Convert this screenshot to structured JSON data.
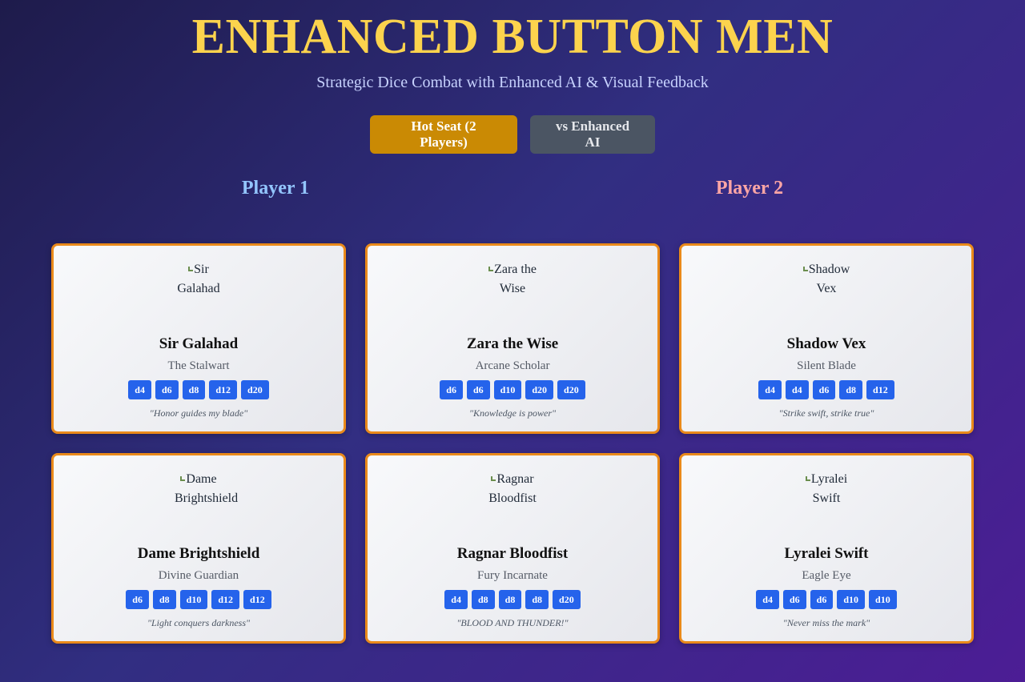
{
  "header": {
    "title": "ENHANCED BUTTON MEN",
    "subtitle": "Strategic Dice Combat with Enhanced AI & Visual Feedback"
  },
  "modes": {
    "hot_seat": "Hot Seat (2 Players)",
    "vs_ai": "vs Enhanced AI",
    "selected": "Hot Seat (2 Players)"
  },
  "players": {
    "p1": "Player 1",
    "p2": "Player 2"
  },
  "characters": [
    {
      "portrait_line1": "Sir",
      "portrait_line2": "Galahad",
      "name": "Sir Galahad",
      "role": "The Stalwart",
      "dice": [
        "d4",
        "d6",
        "d8",
        "d12",
        "d20"
      ],
      "quote": "\"Honor guides my blade\""
    },
    {
      "portrait_line1": "Zara the",
      "portrait_line2": "Wise",
      "name": "Zara the Wise",
      "role": "Arcane Scholar",
      "dice": [
        "d6",
        "d6",
        "d10",
        "d20",
        "d20"
      ],
      "quote": "\"Knowledge is power\""
    },
    {
      "portrait_line1": "Shadow",
      "portrait_line2": "Vex",
      "name": "Shadow Vex",
      "role": "Silent Blade",
      "dice": [
        "d4",
        "d4",
        "d6",
        "d8",
        "d12"
      ],
      "quote": "\"Strike swift, strike true\""
    },
    {
      "portrait_line1": "Dame",
      "portrait_line2": "Brightshield",
      "name": "Dame Brightshield",
      "role": "Divine Guardian",
      "dice": [
        "d6",
        "d8",
        "d10",
        "d12",
        "d12"
      ],
      "quote": "\"Light conquers darkness\""
    },
    {
      "portrait_line1": "Ragnar",
      "portrait_line2": "Bloodfist",
      "name": "Ragnar Bloodfist",
      "role": "Fury Incarnate",
      "dice": [
        "d4",
        "d8",
        "d8",
        "d8",
        "d20"
      ],
      "quote": "\"BLOOD AND THUNDER!\""
    },
    {
      "portrait_line1": "Lyralei",
      "portrait_line2": "Swift",
      "name": "Lyralei Swift",
      "role": "Eagle Eye",
      "dice": [
        "d4",
        "d6",
        "d6",
        "d10",
        "d10"
      ],
      "quote": "\"Never miss the mark\""
    }
  ],
  "colors": {
    "title": "#fcd34d",
    "active_mode": "#ca8a04",
    "inactive_mode": "#4b5563",
    "player1": "#93c5fd",
    "player2": "#fca5a5",
    "card_border": "#ea8a1a",
    "die": "#2563eb"
  }
}
